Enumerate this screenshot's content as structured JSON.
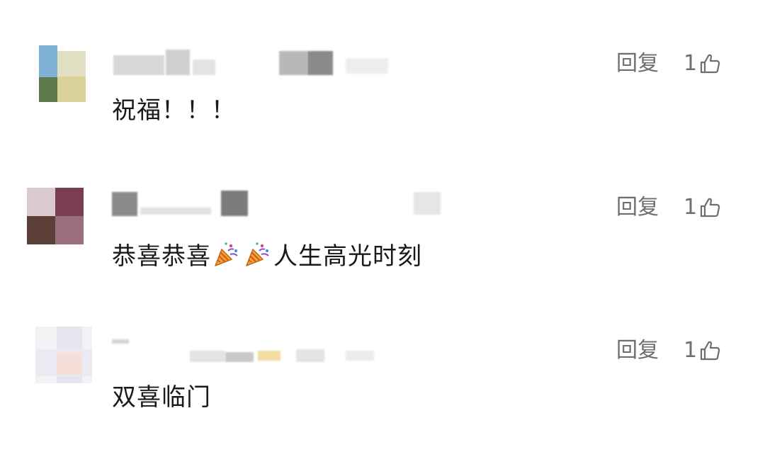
{
  "comments": [
    {
      "text": "祝福！！！",
      "reply_label": "回复",
      "like_count": "1",
      "avatar_colors": [
        "#7fb0d6",
        "#e2e0c2",
        "#5d7a4a",
        "#d9d39a"
      ]
    },
    {
      "text_before": "恭喜恭喜",
      "text_after": "人生高光时刻",
      "emojis": [
        "party-popper-icon",
        "party-popper-icon"
      ],
      "reply_label": "回复",
      "like_count": "1",
      "avatar_colors": [
        "#d9cbcf",
        "#7a3e52",
        "#5c3f37",
        "#9a6e7c"
      ]
    },
    {
      "text": "双喜临门",
      "reply_label": "回复",
      "like_count": "1",
      "avatar_colors": [
        "#e6e4ef",
        "#f6dfd8",
        "#ebe9f1",
        "#f3f1f4"
      ]
    }
  ]
}
